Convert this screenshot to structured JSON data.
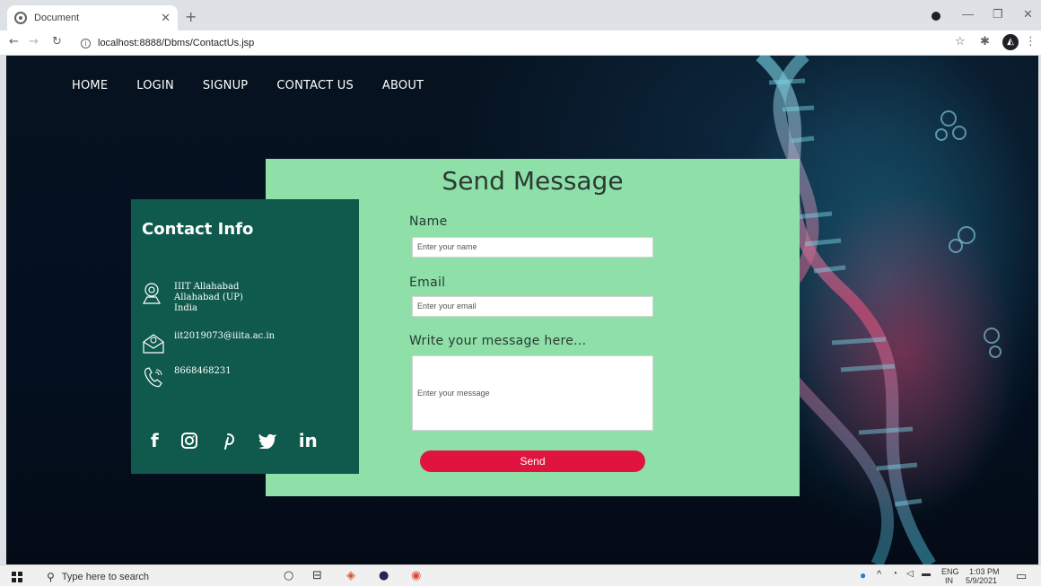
{
  "browser": {
    "tab_title": "Document",
    "url": "localhost:8888/Dbms/ContactUs.jsp"
  },
  "nav": {
    "items": [
      {
        "label": "HOME"
      },
      {
        "label": "LOGIN"
      },
      {
        "label": "SIGNUP"
      },
      {
        "label": "CONTACT US"
      },
      {
        "label": "ABOUT"
      }
    ]
  },
  "contact_info": {
    "title": "Contact Info",
    "address": "IIIT Allahabad\nAllahabad (UP)\nIndia",
    "email": "iit2019073@iiita.ac.in",
    "phone": "8668468231",
    "social_icons": [
      "facebook-icon",
      "instagram-icon",
      "pinterest-icon",
      "twitter-icon",
      "linkedin-icon"
    ]
  },
  "form": {
    "title": "Send Message",
    "name_label": "Name",
    "name_placeholder": "Enter your name",
    "email_label": "Email",
    "email_placeholder": "Enter your email",
    "message_label": "Write your message here...",
    "message_placeholder": "Enter your message",
    "send_label": "Send"
  },
  "taskbar": {
    "search_placeholder": "Type here to search",
    "lang": "ENG",
    "region": "IN",
    "time": "1:03 PM",
    "date": "5/9/2021"
  },
  "colors": {
    "form_bg": "#8ee0a8",
    "info_bg": "#0f5a4d",
    "send_btn": "#e0143f"
  }
}
